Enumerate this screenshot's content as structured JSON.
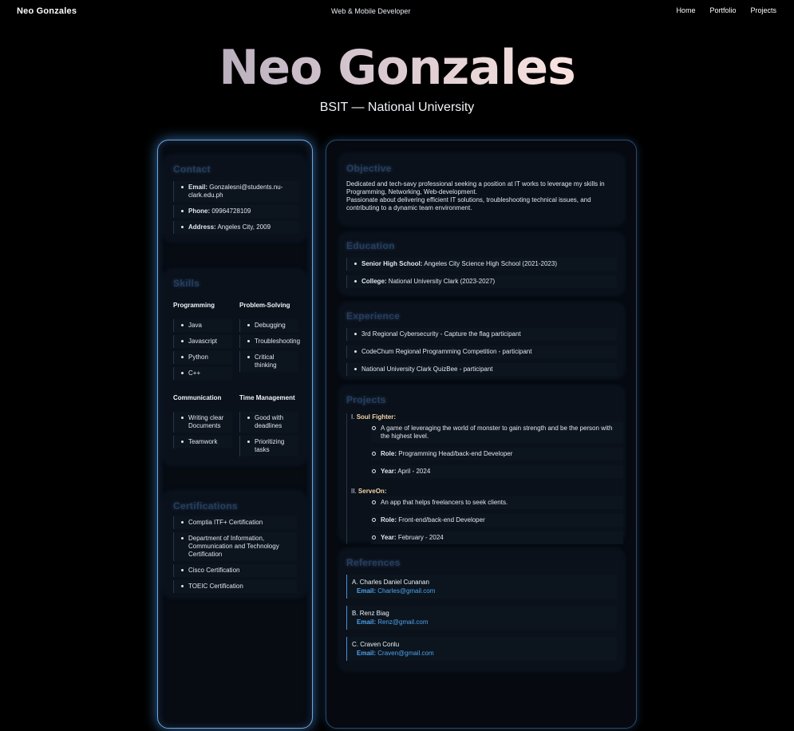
{
  "nav": {
    "brand": "Neo Gonzales",
    "tagline": "Web & Mobile Developer",
    "links": [
      "Home",
      "Portfolio",
      "Projects"
    ]
  },
  "hero": {
    "name": "Neo Gonzales",
    "subtitle": "BSIT — National University"
  },
  "contact": {
    "title": "Contact",
    "items": [
      {
        "label": "Email:",
        "value": "Gonzalesni@students.nu-clark.edu.ph"
      },
      {
        "label": "Phone:",
        "value": "09964728109"
      },
      {
        "label": "Address:",
        "value": "Angeles City, 2009"
      }
    ]
  },
  "skills": {
    "title": "Skills",
    "categories": [
      {
        "name": "Programming",
        "items": [
          "Java",
          "Javascript",
          "Python",
          "C++"
        ]
      },
      {
        "name": "Problem-Solving",
        "items": [
          "Debugging",
          "Troubleshooting",
          "Critical thinking"
        ]
      },
      {
        "name": "Communication",
        "items": [
          "Writing clear Documents",
          "Teamwork"
        ]
      },
      {
        "name": "Time Management",
        "items": [
          "Good with deadlines",
          "Prioritizing tasks"
        ]
      }
    ]
  },
  "certifications": {
    "title": "Certifications",
    "items": [
      "Comptia ITF+ Certification",
      "Department of Information, Communication and Technology Certification",
      "Cisco Certification",
      "TOEIC Certification"
    ]
  },
  "objective": {
    "title": "Objective",
    "line1": "Dedicated and tech-savy professional seeking a position at IT works to leverage my skills in Programming, Networking, Web-development.",
    "line2": "Passionate about delivering efficient IT solutions, troubleshooting technical issues, and contributing to a dynamic team environment."
  },
  "education": {
    "title": "Education",
    "items": [
      {
        "label": "Senior High School:",
        "value": "Angeles City Science High School (2021-2023)"
      },
      {
        "label": "College:",
        "value": "National University Clark (2023-2027)"
      }
    ]
  },
  "experience": {
    "title": "Experience",
    "items": [
      "3rd Regional Cybersecurity - Capture the flag participant",
      "CodeChum Regional Programming Competition - participant",
      "National University Clark QuizBee - participant"
    ]
  },
  "projects": {
    "title": "Projects",
    "items": [
      {
        "num": "I.",
        "name": "Soul Fighter:",
        "desc": "A game of leveraging the world of monster to gain strength and be the person with the highest level.",
        "role_label": "Role:",
        "role": "Programming Head/back-end Developer",
        "year_label": "Year:",
        "year": "April - 2024"
      },
      {
        "num": "II.",
        "name": "ServeOn:",
        "desc": "An app that helps freelancers to seek clients.",
        "role_label": "Role:",
        "role": "Front-end/back-end Developer",
        "year_label": "Year:",
        "year": "February - 2024"
      }
    ]
  },
  "references": {
    "title": "References",
    "email_label": "Email:",
    "items": [
      {
        "name": "A. Charles Daniel Cunanan",
        "email": "Charles@gmail.com"
      },
      {
        "name": "B. Renz Biag",
        "email": "Renz@gmail.com"
      },
      {
        "name": "C. Craven Conlu",
        "email": "Craven@gmail.com"
      }
    ]
  },
  "colors": {
    "background": "#000000",
    "accent_glow": "#6ea6de",
    "heading": "#273d5a",
    "link": "#4ea3ec"
  }
}
